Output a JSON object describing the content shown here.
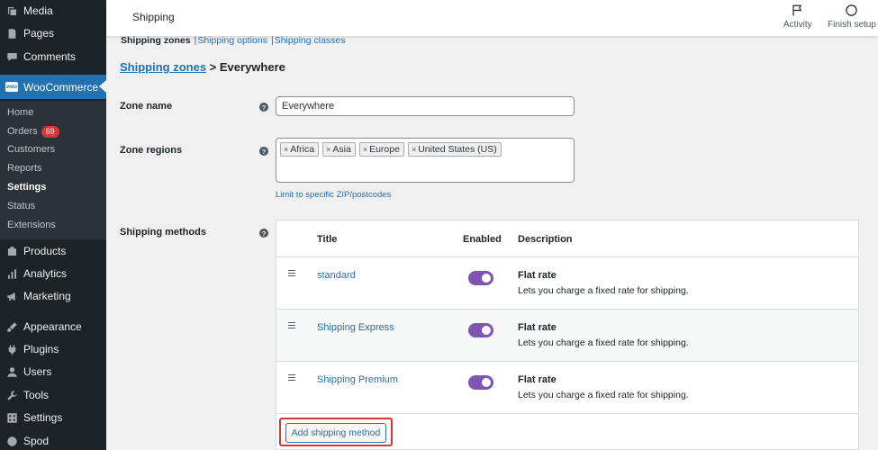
{
  "sidebar": {
    "items": [
      {
        "label": "Media",
        "icon": "media-icon"
      },
      {
        "label": "Pages",
        "icon": "pages-icon"
      },
      {
        "label": "Comments",
        "icon": "comments-icon"
      },
      {
        "label": "WooCommerce",
        "icon": "woocommerce-icon"
      },
      {
        "label": "Products",
        "icon": "products-icon"
      },
      {
        "label": "Analytics",
        "icon": "analytics-icon"
      },
      {
        "label": "Marketing",
        "icon": "marketing-icon"
      },
      {
        "label": "Appearance",
        "icon": "appearance-icon"
      },
      {
        "label": "Plugins",
        "icon": "plugins-icon"
      },
      {
        "label": "Users",
        "icon": "users-icon"
      },
      {
        "label": "Tools",
        "icon": "tools-icon"
      },
      {
        "label": "Settings",
        "icon": "settings-icon"
      },
      {
        "label": "Spod",
        "icon": "spod-icon"
      }
    ],
    "woo_logo_text": "woo",
    "submenu": [
      {
        "label": "Home"
      },
      {
        "label": "Orders",
        "badge": "69"
      },
      {
        "label": "Customers"
      },
      {
        "label": "Reports"
      },
      {
        "label": "Settings"
      },
      {
        "label": "Status"
      },
      {
        "label": "Extensions"
      }
    ]
  },
  "header": {
    "title": "Shipping",
    "activity_label": "Activity",
    "finish_setup_label": "Finish setup"
  },
  "tabs": [
    "Shipping zones",
    "Shipping options",
    "Shipping classes"
  ],
  "breadcrumb": {
    "link": "Shipping zones",
    "current": " > Everywhere"
  },
  "form": {
    "zone_name_label": "Zone name",
    "zone_name_value": "Everywhere",
    "zone_regions_label": "Zone regions",
    "regions": [
      "Africa",
      "Asia",
      "Europe",
      "United States (US)"
    ],
    "limit_link": "Limit to specific ZIP/postcodes",
    "shipping_methods_label": "Shipping methods",
    "help_glyph": "?",
    "remove_glyph": "×"
  },
  "methods": {
    "headers": {
      "title": "Title",
      "enabled": "Enabled",
      "description": "Description"
    },
    "rows": [
      {
        "title": "standard",
        "enabled": true,
        "name": "Flat rate",
        "desc": "Lets you charge a fixed rate for shipping."
      },
      {
        "title": "Shipping Express",
        "enabled": true,
        "name": "Flat rate",
        "desc": "Lets you charge a fixed rate for shipping."
      },
      {
        "title": "Shipping Premium",
        "enabled": true,
        "name": "Flat rate",
        "desc": "Lets you charge a fixed rate for shipping."
      }
    ],
    "add_button": "Add shipping method"
  },
  "colors": {
    "sidebar_bg": "#1d2327",
    "accent": "#2271b1",
    "toggle_on": "#7f54b3",
    "badge": "#d63638",
    "highlight_border": "#d63638"
  }
}
